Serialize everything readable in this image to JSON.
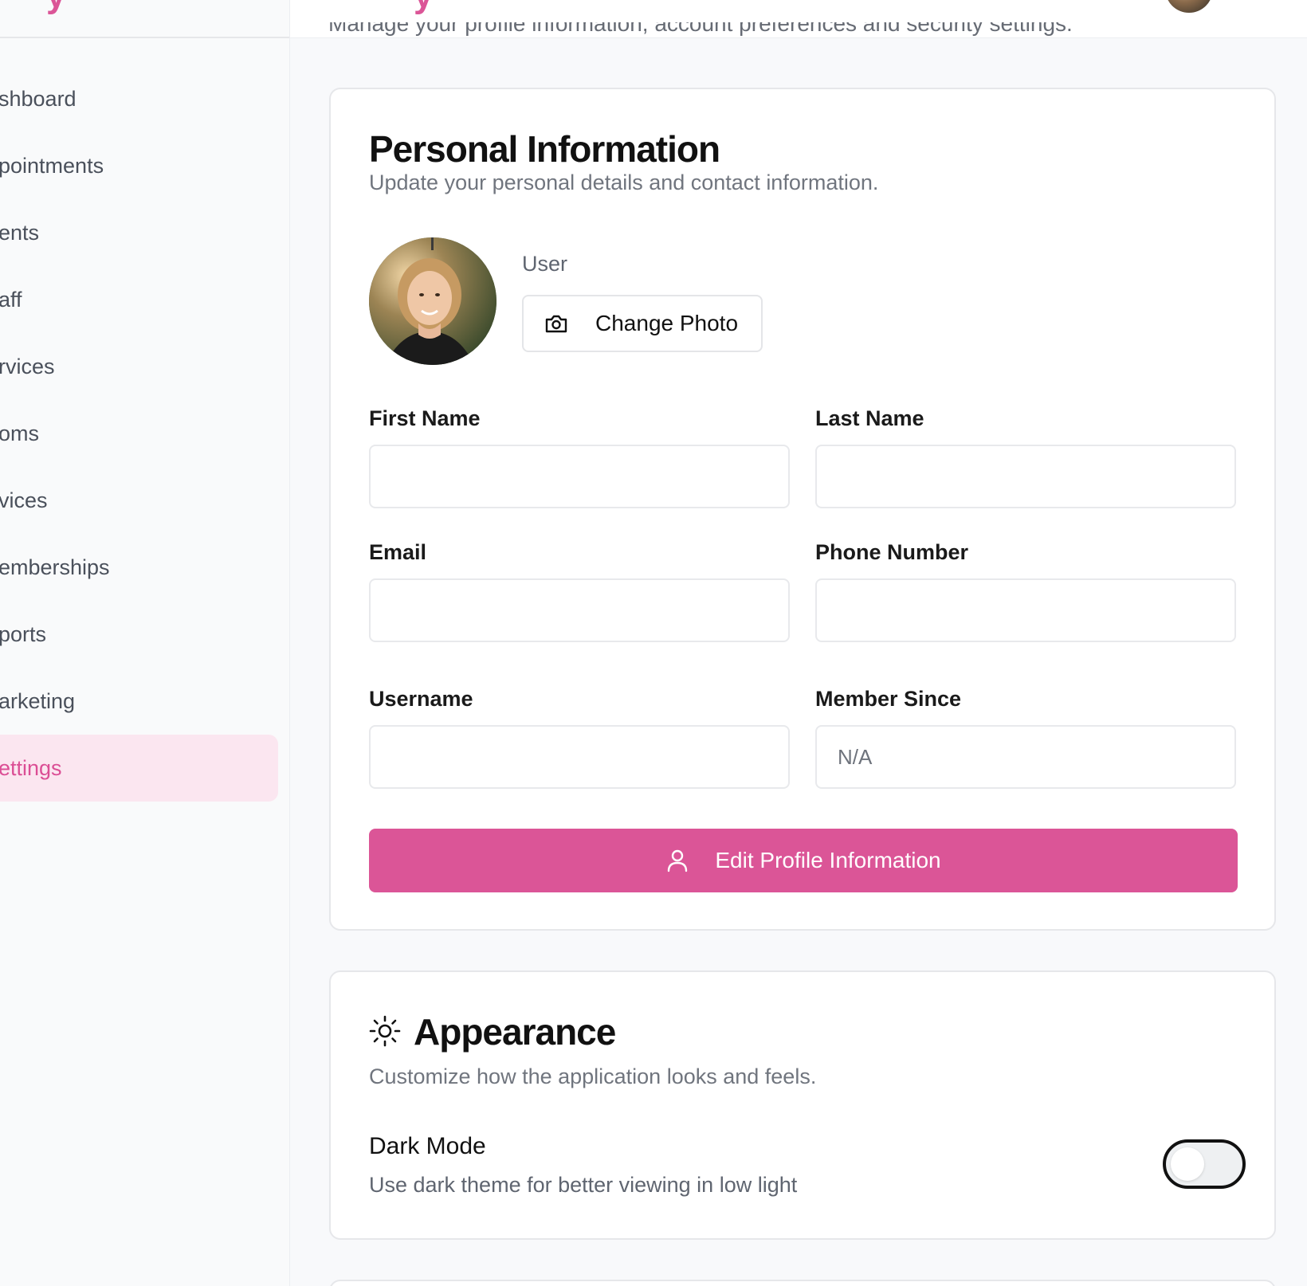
{
  "sidebar": {
    "brand_fragment": "y",
    "items": [
      {
        "label": "shboard",
        "active": false
      },
      {
        "label": "pointments",
        "active": false
      },
      {
        "label": "ents",
        "active": false
      },
      {
        "label": "aff",
        "active": false
      },
      {
        "label": "rvices",
        "active": false
      },
      {
        "label": "oms",
        "active": false
      },
      {
        "label": "vices",
        "active": false
      },
      {
        "label": "emberships",
        "active": false
      },
      {
        "label": "ports",
        "active": false
      },
      {
        "label": "arketing",
        "active": false
      },
      {
        "label": "ettings",
        "active": true
      }
    ]
  },
  "header": {
    "title_fragment": "y",
    "subtitle": "Manage your profile information, account preferences and security settings."
  },
  "personal": {
    "title": "Personal Information",
    "description": "Update your personal details and contact information.",
    "user_label": "User",
    "change_photo_label": "Change Photo",
    "fields": {
      "first_name": {
        "label": "First Name",
        "value": ""
      },
      "last_name": {
        "label": "Last Name",
        "value": ""
      },
      "email": {
        "label": "Email",
        "value": ""
      },
      "phone": {
        "label": "Phone Number",
        "value": ""
      },
      "username": {
        "label": "Username",
        "value": ""
      },
      "member_since": {
        "label": "Member Since",
        "value": "N/A"
      }
    },
    "edit_button_label": "Edit Profile Information"
  },
  "appearance": {
    "title": "Appearance",
    "description": "Customize how the application looks and feels.",
    "dark_mode": {
      "label": "Dark Mode",
      "description": "Use dark theme for better viewing in low light",
      "enabled": false
    }
  },
  "colors": {
    "accent": "#db5597",
    "active_bg": "#fbe6f0",
    "page_bg": "#f8f9fb"
  },
  "icons": {
    "change_photo": "camera-icon",
    "edit_profile": "user-icon",
    "appearance": "sun-icon"
  }
}
